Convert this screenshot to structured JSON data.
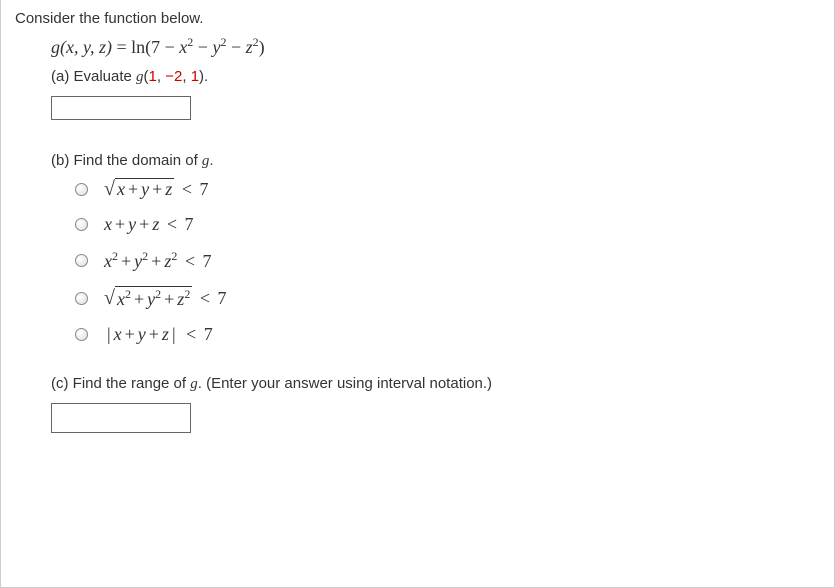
{
  "intro": "Consider the function below.",
  "func": {
    "g": "g",
    "args": "(x, y, z)",
    "eq": " = ",
    "ln": "ln(7 − ",
    "x2": "x",
    "minus1": " − ",
    "y2": "y",
    "minus2": " − ",
    "z2": "z",
    "close": ")"
  },
  "part_a": {
    "label_pre": "(a) Evaluate ",
    "g": "g",
    "args_open": "(",
    "v1": "1",
    "c1": ", ",
    "v2": "−2",
    "c2": ", ",
    "v3": "1",
    "args_close": ").",
    "value": ""
  },
  "part_b": {
    "label_pre": "(b) Find the domain of ",
    "g": "g",
    "period": ".",
    "options": [
      {
        "id": "opt1",
        "sqrt": true,
        "squared": false,
        "abs": false,
        "text_x": "x",
        "text_y": "y",
        "text_z": "z",
        "lt": " < ",
        "rhs": "7"
      },
      {
        "id": "opt2",
        "sqrt": false,
        "squared": false,
        "abs": false,
        "text_x": "x",
        "text_y": "y",
        "text_z": "z",
        "lt": " < ",
        "rhs": "7"
      },
      {
        "id": "opt3",
        "sqrt": false,
        "squared": true,
        "abs": false,
        "text_x": "x",
        "text_y": "y",
        "text_z": "z",
        "lt": " < ",
        "rhs": "7"
      },
      {
        "id": "opt4",
        "sqrt": true,
        "squared": true,
        "abs": false,
        "text_x": "x",
        "text_y": "y",
        "text_z": "z",
        "lt": " < ",
        "rhs": "7"
      },
      {
        "id": "opt5",
        "sqrt": false,
        "squared": false,
        "abs": true,
        "text_x": "x",
        "text_y": "y",
        "text_z": "z",
        "lt": " < ",
        "rhs": "7"
      }
    ]
  },
  "part_c": {
    "label_pre": "(c) Find the range of ",
    "g": "g",
    "label_post": ". (Enter your answer using interval notation.)",
    "value": ""
  }
}
